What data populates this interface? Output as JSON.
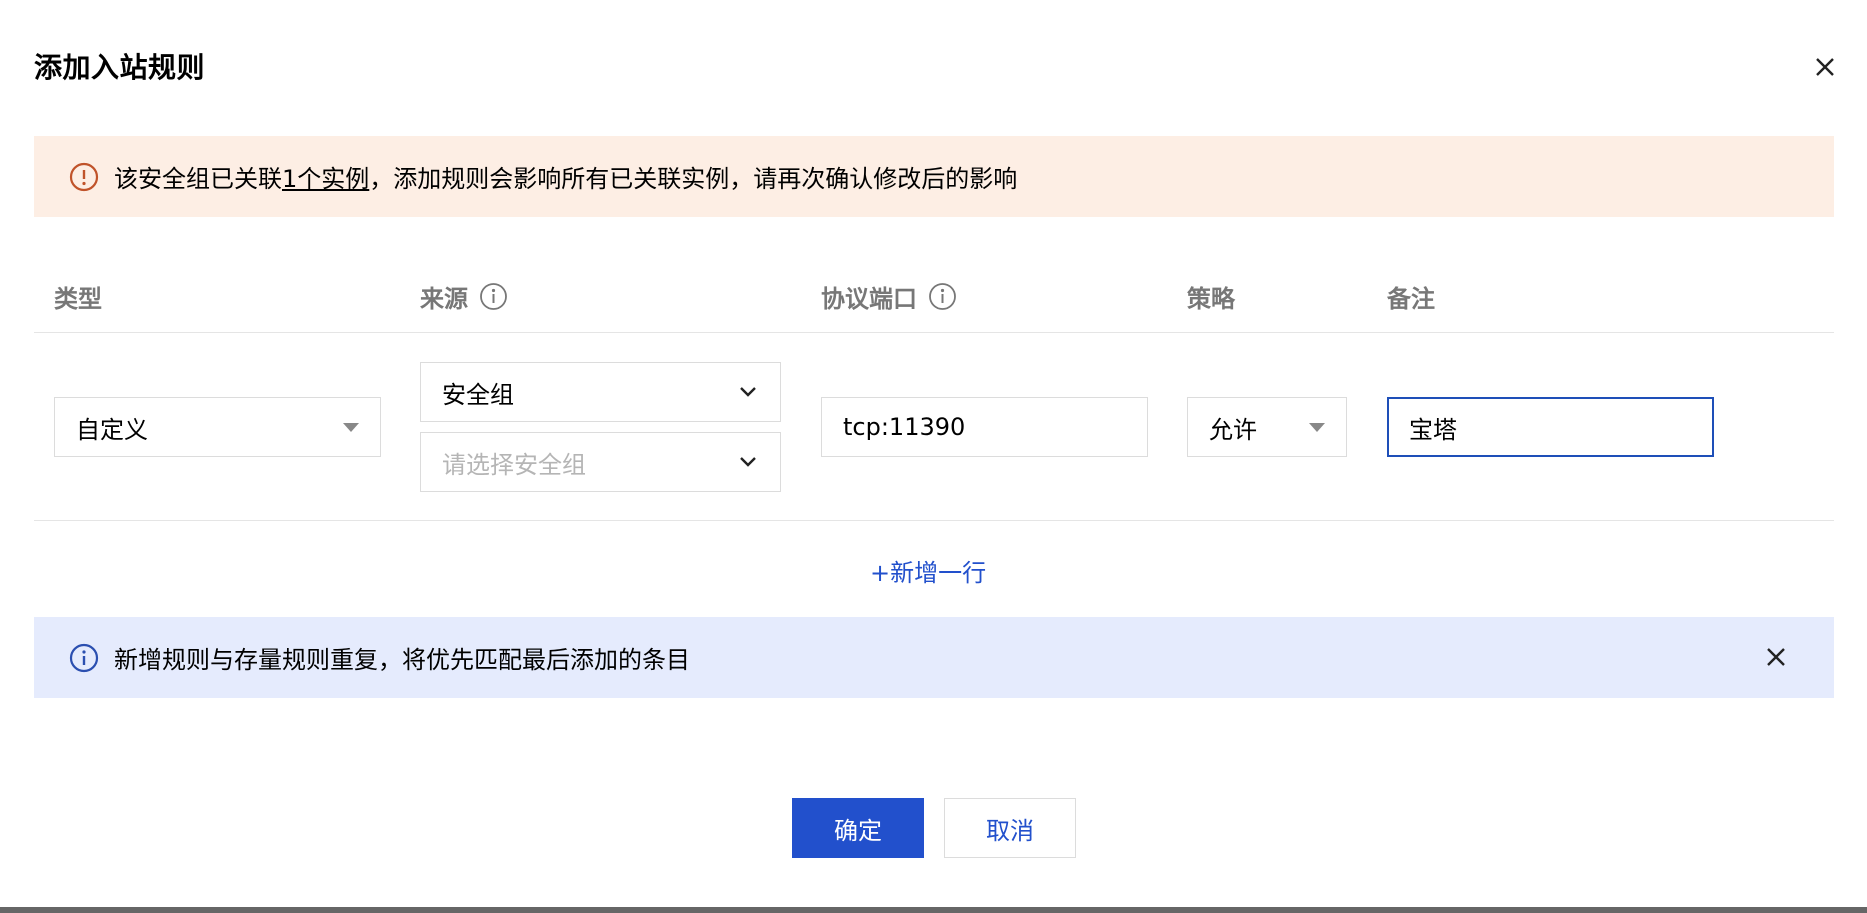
{
  "dialog": {
    "title": "添加入站规则"
  },
  "warning": {
    "text_before": "该安全组已关联",
    "link": "1个实例",
    "text_after": "，添加规则会影响所有已关联实例，请再次确认修改后的影响",
    "icon": "exclamation-circle-icon",
    "color": "#fdeee4"
  },
  "table": {
    "headers": {
      "type": "类型",
      "source": "来源",
      "protocol_port": "协议端口",
      "policy": "策略",
      "remark": "备注"
    },
    "row": {
      "type": "自定义",
      "source_type": "安全组",
      "source_group_placeholder": "请选择安全组",
      "protocol_port": "tcp:11390",
      "policy": "允许",
      "remark": "宝塔"
    }
  },
  "add_row_label": "+新增一行",
  "info": {
    "text": "新增规则与存量规则重复，将优先匹配最后添加的条目",
    "icon": "info-circle-icon",
    "color": "#e5ebfd"
  },
  "buttons": {
    "confirm": "确定",
    "cancel": "取消"
  },
  "colors": {
    "accent": "#2250cc",
    "warning_icon": "#c0532a",
    "info_icon": "#2b4fb0"
  }
}
